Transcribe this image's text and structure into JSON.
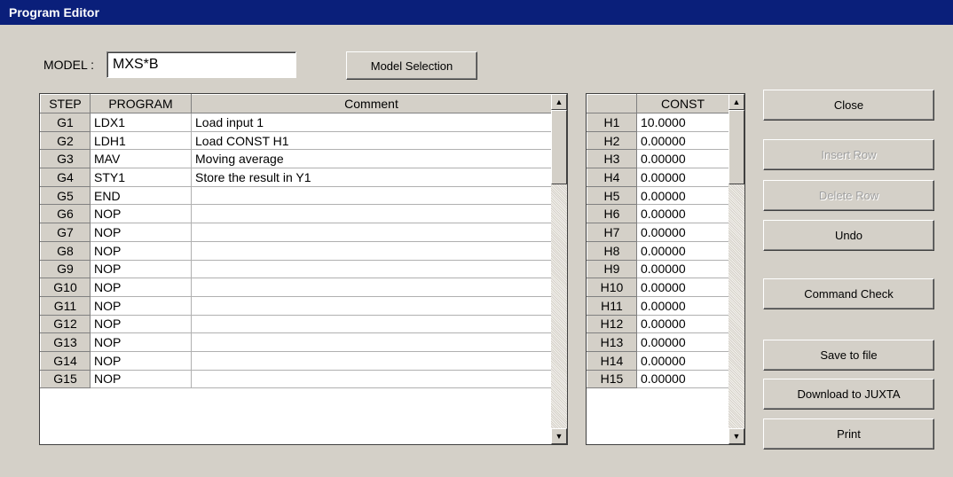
{
  "window": {
    "title": "Program Editor"
  },
  "model": {
    "label": "MODEL :",
    "value": "MXS*B",
    "selection_button": "Model Selection"
  },
  "program_table": {
    "headers": [
      "STEP",
      "PROGRAM",
      "Comment"
    ],
    "rows": [
      [
        "G1",
        "LDX1",
        "Load input 1"
      ],
      [
        "G2",
        "LDH1",
        "Load CONST H1"
      ],
      [
        "G3",
        "MAV",
        "Moving average"
      ],
      [
        "G4",
        "STY1",
        "Store the result in Y1"
      ],
      [
        "G5",
        "END",
        ""
      ],
      [
        "G6",
        "NOP",
        ""
      ],
      [
        "G7",
        "NOP",
        ""
      ],
      [
        "G8",
        "NOP",
        ""
      ],
      [
        "G9",
        "NOP",
        ""
      ],
      [
        "G10",
        "NOP",
        ""
      ],
      [
        "G11",
        "NOP",
        ""
      ],
      [
        "G12",
        "NOP",
        ""
      ],
      [
        "G13",
        "NOP",
        ""
      ],
      [
        "G14",
        "NOP",
        ""
      ],
      [
        "G15",
        "NOP",
        ""
      ]
    ]
  },
  "const_table": {
    "headers": [
      "",
      "CONST"
    ],
    "rows": [
      [
        "H1",
        "10.0000"
      ],
      [
        "H2",
        "0.00000"
      ],
      [
        "H3",
        "0.00000"
      ],
      [
        "H4",
        "0.00000"
      ],
      [
        "H5",
        "0.00000"
      ],
      [
        "H6",
        "0.00000"
      ],
      [
        "H7",
        "0.00000"
      ],
      [
        "H8",
        "0.00000"
      ],
      [
        "H9",
        "0.00000"
      ],
      [
        "H10",
        "0.00000"
      ],
      [
        "H11",
        "0.00000"
      ],
      [
        "H12",
        "0.00000"
      ],
      [
        "H13",
        "0.00000"
      ],
      [
        "H14",
        "0.00000"
      ],
      [
        "H15",
        "0.00000"
      ]
    ]
  },
  "buttons": {
    "close": "Close",
    "insert_row": "Insert Row",
    "delete_row": "Delete Row",
    "undo": "Undo",
    "command_check": "Command Check",
    "save_to_file": "Save to file",
    "download": "Download to JUXTA",
    "print": "Print"
  },
  "icons": {
    "scroll_up": "scroll-up-arrow-icon",
    "scroll_down": "scroll-down-arrow-icon"
  }
}
